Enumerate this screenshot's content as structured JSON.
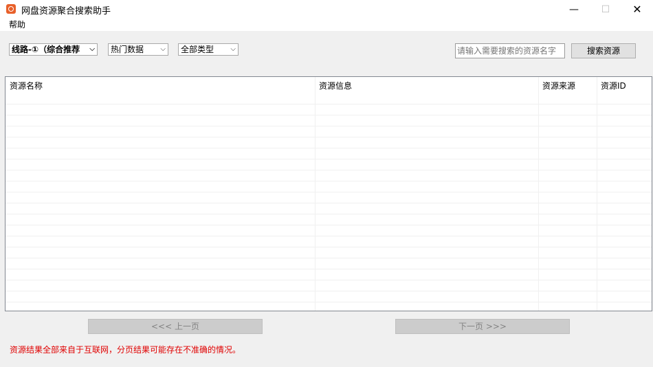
{
  "window": {
    "title": "网盘资源聚合搜索助手",
    "minimize_glyph": "—",
    "maximize_glyph": "☐",
    "close_glyph": "✕"
  },
  "menu": {
    "help": "帮助"
  },
  "toolbar": {
    "line_select": "线路-①（综合推荐",
    "category_select": "热门数据",
    "type_select": "全部类型",
    "dropdown_glyph": "⌵",
    "search_placeholder": "请输入需要搜索的资源名字",
    "search_button": "搜索资源"
  },
  "table": {
    "columns": [
      "资源名称",
      "资源信息",
      "资源来源",
      "资源ID"
    ],
    "rows": []
  },
  "pagination": {
    "prev": "<<<   上一页",
    "next": "下一页   >>>"
  },
  "notice": "资源结果全部来自于互联网，分页结果可能存在不准确的情况。",
  "colors": {
    "notice": "#e00000",
    "app_icon": "#e8602a"
  }
}
